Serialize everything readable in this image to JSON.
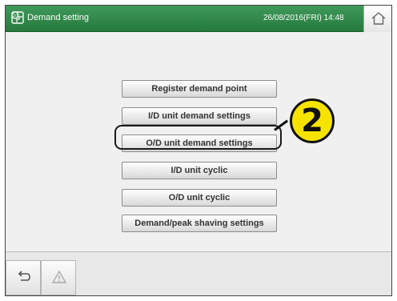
{
  "header": {
    "title": "Demand setting",
    "datetime": "26/08/2016(FRI) 14:48"
  },
  "menu": {
    "items": [
      {
        "label": "Register demand point"
      },
      {
        "label": "I/D unit demand settings"
      },
      {
        "label": "O/D unit demand settings",
        "highlighted": true
      },
      {
        "label": "I/D unit cyclic"
      },
      {
        "label": "O/D unit cyclic"
      },
      {
        "label": "Demand/peak shaving settings"
      }
    ]
  },
  "annotation": {
    "step_number": "2",
    "color": "#f6e400"
  },
  "footer": {
    "back_icon": "back-arrow-icon",
    "alert_icon": "warning-icon"
  },
  "colors": {
    "titlebar": "#2f8a4a",
    "background": "#f0f0f0"
  }
}
